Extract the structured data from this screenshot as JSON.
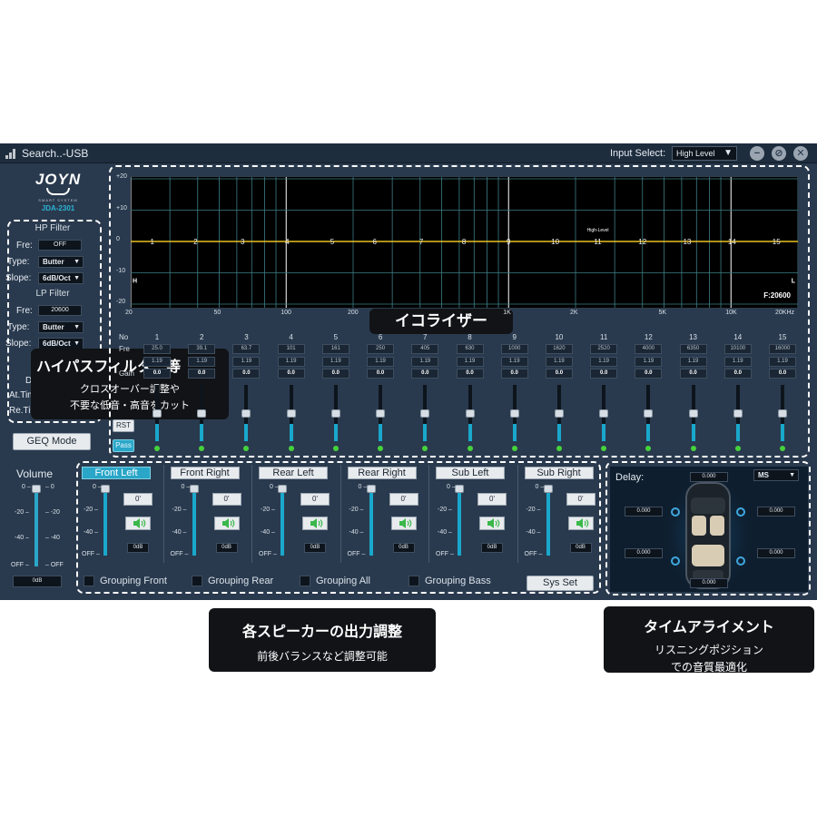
{
  "titlebar": {
    "title": "Search..-USB",
    "input_select_label": "Input Select:",
    "input_select_value": "High Level"
  },
  "logo": {
    "brand": "JOYN",
    "subtitle": "SMART SYSTEM",
    "model": "JDA-2301"
  },
  "filter": {
    "hp_title": "HP Filter",
    "hp_fre_label": "Fre:",
    "hp_fre_value": "OFF",
    "hp_type_label": "Type:",
    "hp_type_value": "Butter",
    "hp_slope_label": "Slope:",
    "hp_slope_value": "6dB/Oct",
    "lp_title": "LP Filter",
    "lp_fre_label": "Fre:",
    "lp_fre_value": "20600",
    "lp_type_label": "Type:",
    "lp_type_value": "Butter",
    "lp_slope_label": "Slope:",
    "lp_slope_value": "6dB/Oct",
    "dbu_label": "DBu:",
    "at_time_label": "At.Time:",
    "re_time_label": "Re.Time:"
  },
  "callouts": {
    "hp_title": "ハイパスフィルター等",
    "hp_line1": "クロスオーバー調整や",
    "hp_line2": "不要な低音・高音をカット",
    "eq_title": "イコライザー",
    "out_title": "各スピーカーの出力調整",
    "out_line1": "前後バランスなど調整可能",
    "time_title": "タイムアライメント",
    "time_line1": "リスニングポジション",
    "time_line2": "での音質最適化"
  },
  "geq_mode": "GEQ Mode",
  "graph": {
    "y_labels": [
      "+20",
      "+10",
      "0",
      "-10",
      "-20"
    ],
    "x_labels": [
      "20",
      "50",
      "100",
      "200",
      "1K",
      "2K",
      "5K",
      "10K",
      "20KHz"
    ],
    "band_markers": [
      "1",
      "2",
      "3",
      "4",
      "5",
      "6",
      "7",
      "8",
      "9",
      "10",
      "11",
      "12",
      "13",
      "14",
      "15"
    ],
    "h_left": "H",
    "l_right": "L",
    "freq_readout": "F:20600",
    "high_level_label": "High-Level"
  },
  "eq": {
    "no_label": "No",
    "fre_label": "Fre",
    "q_label": "Q",
    "gain_label": "Gain",
    "bands": [
      {
        "no": "1",
        "fre": "25.0",
        "q": "1.19",
        "gain": "0.0"
      },
      {
        "no": "2",
        "fre": "39.1",
        "q": "1.19",
        "gain": "0.0"
      },
      {
        "no": "3",
        "fre": "63.7",
        "q": "1.19",
        "gain": "0.0"
      },
      {
        "no": "4",
        "fre": "101",
        "q": "1.19",
        "gain": "0.0"
      },
      {
        "no": "5",
        "fre": "161",
        "q": "1.19",
        "gain": "0.0"
      },
      {
        "no": "6",
        "fre": "250",
        "q": "1.19",
        "gain": "0.0"
      },
      {
        "no": "7",
        "fre": "405",
        "q": "1.19",
        "gain": "0.0"
      },
      {
        "no": "8",
        "fre": "630",
        "q": "1.19",
        "gain": "0.0"
      },
      {
        "no": "9",
        "fre": "1000",
        "q": "1.19",
        "gain": "0.0"
      },
      {
        "no": "10",
        "fre": "1620",
        "q": "1.19",
        "gain": "0.0"
      },
      {
        "no": "11",
        "fre": "2520",
        "q": "1.19",
        "gain": "0.0"
      },
      {
        "no": "12",
        "fre": "4000",
        "q": "1.19",
        "gain": "0.0"
      },
      {
        "no": "13",
        "fre": "6350",
        "q": "1.19",
        "gain": "0.0"
      },
      {
        "no": "14",
        "fre": "10100",
        "q": "1.19",
        "gain": "0.0"
      },
      {
        "no": "15",
        "fre": "16000",
        "q": "1.19",
        "gain": "0.0"
      }
    ],
    "rst": "RST",
    "pass": "Pass"
  },
  "volume": {
    "title": "Volume",
    "ticks": [
      "0",
      "-20",
      "-40",
      "OFF"
    ],
    "value": "0dB",
    "level": 1.0
  },
  "channels": [
    {
      "name": "Front Left",
      "phase": "0'",
      "db": "0dB",
      "selected": true
    },
    {
      "name": "Front Right",
      "phase": "0'",
      "db": "0dB",
      "selected": false
    },
    {
      "name": "Rear Left",
      "phase": "0'",
      "db": "0dB",
      "selected": false
    },
    {
      "name": "Rear Right",
      "phase": "0'",
      "db": "0dB",
      "selected": false
    },
    {
      "name": "Sub Left",
      "phase": "0'",
      "db": "0dB",
      "selected": false
    },
    {
      "name": "Sub Right",
      "phase": "0'",
      "db": "0dB",
      "selected": false
    }
  ],
  "channel_ticks": [
    "0",
    "-20",
    "-40",
    "OFF"
  ],
  "grouping": [
    "Grouping Front",
    "Grouping Rear",
    "Grouping All",
    "Grouping Bass"
  ],
  "sys_set": "Sys Set",
  "delay": {
    "title": "Delay:",
    "unit": "MS",
    "top": "0.000",
    "left_front": "0.000",
    "right_front": "0.000",
    "left_rear": "0.000",
    "right_rear": "0.000",
    "bottom": "0.000"
  },
  "colors": {
    "accent": "#2aa6c8",
    "eq_curve": "#e8c020",
    "led": "#46d23c"
  }
}
